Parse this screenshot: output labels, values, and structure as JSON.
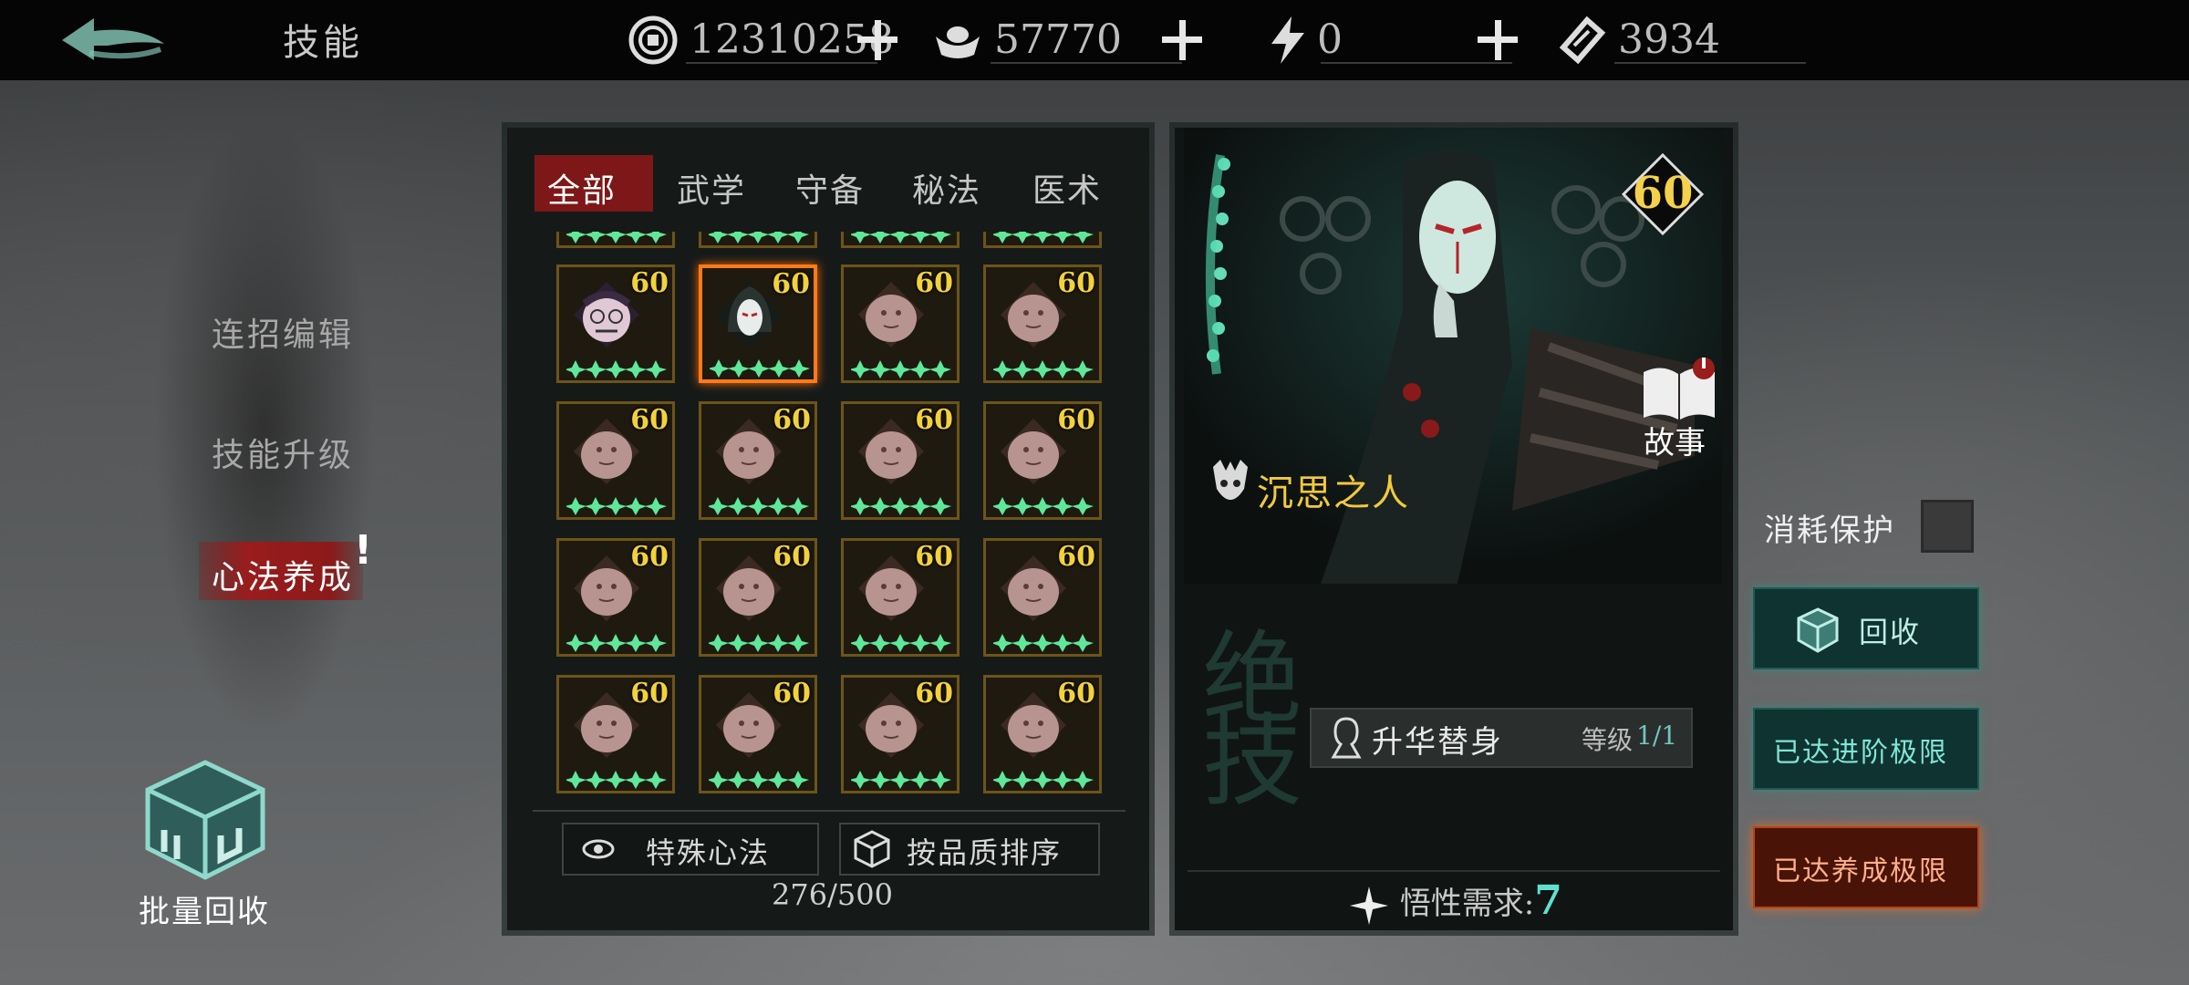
{
  "topbar": {
    "title": "技能",
    "currencies": [
      {
        "icon": "coin-icon",
        "value": "12310258"
      },
      {
        "icon": "silver-ingot-icon",
        "value": "57770"
      },
      {
        "icon": "lightning-icon",
        "value": "0"
      },
      {
        "icon": "ticket-icon",
        "value": "3934"
      }
    ]
  },
  "sidebar": {
    "items": [
      {
        "label": "连招编辑"
      },
      {
        "label": "技能升级"
      },
      {
        "label": "心法养成"
      }
    ],
    "active_index": 2,
    "batch_recycle_label": "批量回收"
  },
  "inventory": {
    "tabs": [
      {
        "label": "全部"
      },
      {
        "label": "武学"
      },
      {
        "label": "守备"
      },
      {
        "label": "秘法"
      },
      {
        "label": "医术"
      }
    ],
    "active_tab": 0,
    "level_label": "60",
    "special_button": "特殊心法",
    "sort_button": "按品质排序",
    "count": "276/500"
  },
  "detail": {
    "level": "60",
    "story_label": "故事",
    "name": "沉思之人",
    "ult_char": "绝技",
    "skill_name": "升华替身",
    "skill_level_label": "等级",
    "skill_level_value": "1/1",
    "requirement_label": "悟性需求:",
    "requirement_value": "7"
  },
  "actions": {
    "protect_label": "消耗保护",
    "recycle_label": "回收",
    "advance_label": "已达进阶极限",
    "cultivate_label": "已达养成极限"
  },
  "colors": {
    "level_gold": "#f2d23c",
    "tab_active": "#7e1717",
    "selected_border": "#ff7a1a",
    "teal_accent": "#5fe0cf"
  }
}
